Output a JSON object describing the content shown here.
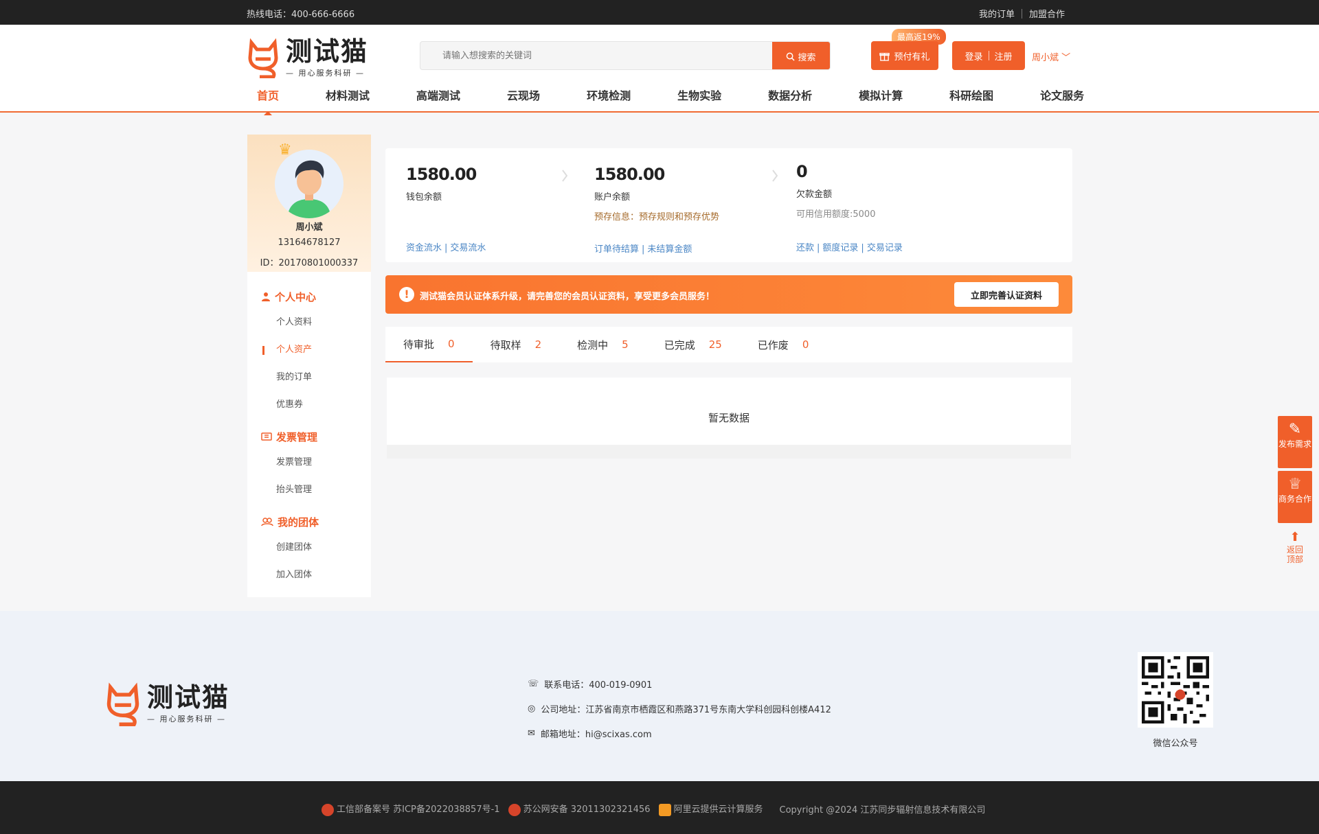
{
  "topbar": {
    "hotline": "热线电话：400-666-6666",
    "my_orders": "我的订单",
    "join": "加盟合作"
  },
  "header": {
    "logo_brand": "测试猫",
    "logo_slogan": "— 用心服务科研 —",
    "search_placeholder": "请输入想搜索的关键词",
    "search_button": "搜索",
    "prepay_badge": "最高返19%",
    "prepay_label": "预付有礼",
    "login": "登录",
    "register": "注册",
    "user_name": "周小斌"
  },
  "nav": [
    {
      "label": "首页",
      "active": true
    },
    {
      "label": "材料测试"
    },
    {
      "label": "高端测试"
    },
    {
      "label": "云现场"
    },
    {
      "label": "环境检测"
    },
    {
      "label": "生物实验"
    },
    {
      "label": "数据分析"
    },
    {
      "label": "模拟计算"
    },
    {
      "label": "科研绘图"
    },
    {
      "label": "论文服务"
    }
  ],
  "profile": {
    "name": "周小斌",
    "phone": "13164678127",
    "uid": "ID：20170801000337"
  },
  "sidebar": {
    "groups": [
      {
        "title": "个人中心",
        "icon": "person-icon",
        "items": [
          "个人资料",
          "个人资产",
          "我的订单",
          "优惠券"
        ]
      },
      {
        "title": "发票管理",
        "icon": "ticket-icon",
        "items": [
          "发票管理",
          "抬头管理"
        ]
      },
      {
        "title": "我的团体",
        "icon": "group-icon",
        "items": [
          "创建团体",
          "加入团体"
        ]
      }
    ],
    "active_item": "个人资产"
  },
  "stats": {
    "wallet": {
      "value": "1580.00",
      "label": "钱包余额",
      "link1": "资金流水",
      "link2": "交易流水"
    },
    "account": {
      "value": "1580.00",
      "label": "账户余额",
      "note": "预存信息：预存规则和预存优势",
      "link1": "订单待结算",
      "link2": "未结算金额"
    },
    "debt": {
      "value": "0",
      "label": "欠款金额",
      "note": "可用信用额度:5000",
      "link1": "还款",
      "link2": "额度记录",
      "link3": "交易记录"
    }
  },
  "alert": {
    "message": "测试猫会员认证体系升级，请完善您的会员认证资料，享受更多会员服务！",
    "button": "立即完善认证资料"
  },
  "tabs": [
    {
      "label": "待审批",
      "count": "0",
      "active": true
    },
    {
      "label": "待取样",
      "count": "2"
    },
    {
      "label": "检测中",
      "count": "5"
    },
    {
      "label": "已完成",
      "count": "25"
    },
    {
      "label": "已作废",
      "count": "0"
    }
  ],
  "empty_text": "暂无数据",
  "float": {
    "publish": "发布需求",
    "business": "商务合作",
    "back_top": "返回顶部"
  },
  "footer": {
    "phone": "联系电话：400-019-0901",
    "address": "公司地址：江苏省南京市栖霞区和燕路371号东南大学科创园科创楼A412",
    "email": "邮箱地址：hi@scixas.com",
    "qr_label": "微信公众号",
    "icp": "工信部备案号 苏ICP备2022038857号-1",
    "police": "苏公网安备 32011302321456",
    "aliyun": "阿里云提供云计算服务",
    "copyright": "Copyright @2024 江苏同步辐射信息技术有限公司"
  },
  "colors": {
    "accent": "#f05f2a",
    "link": "#4a86c5",
    "dark": "#222222"
  }
}
